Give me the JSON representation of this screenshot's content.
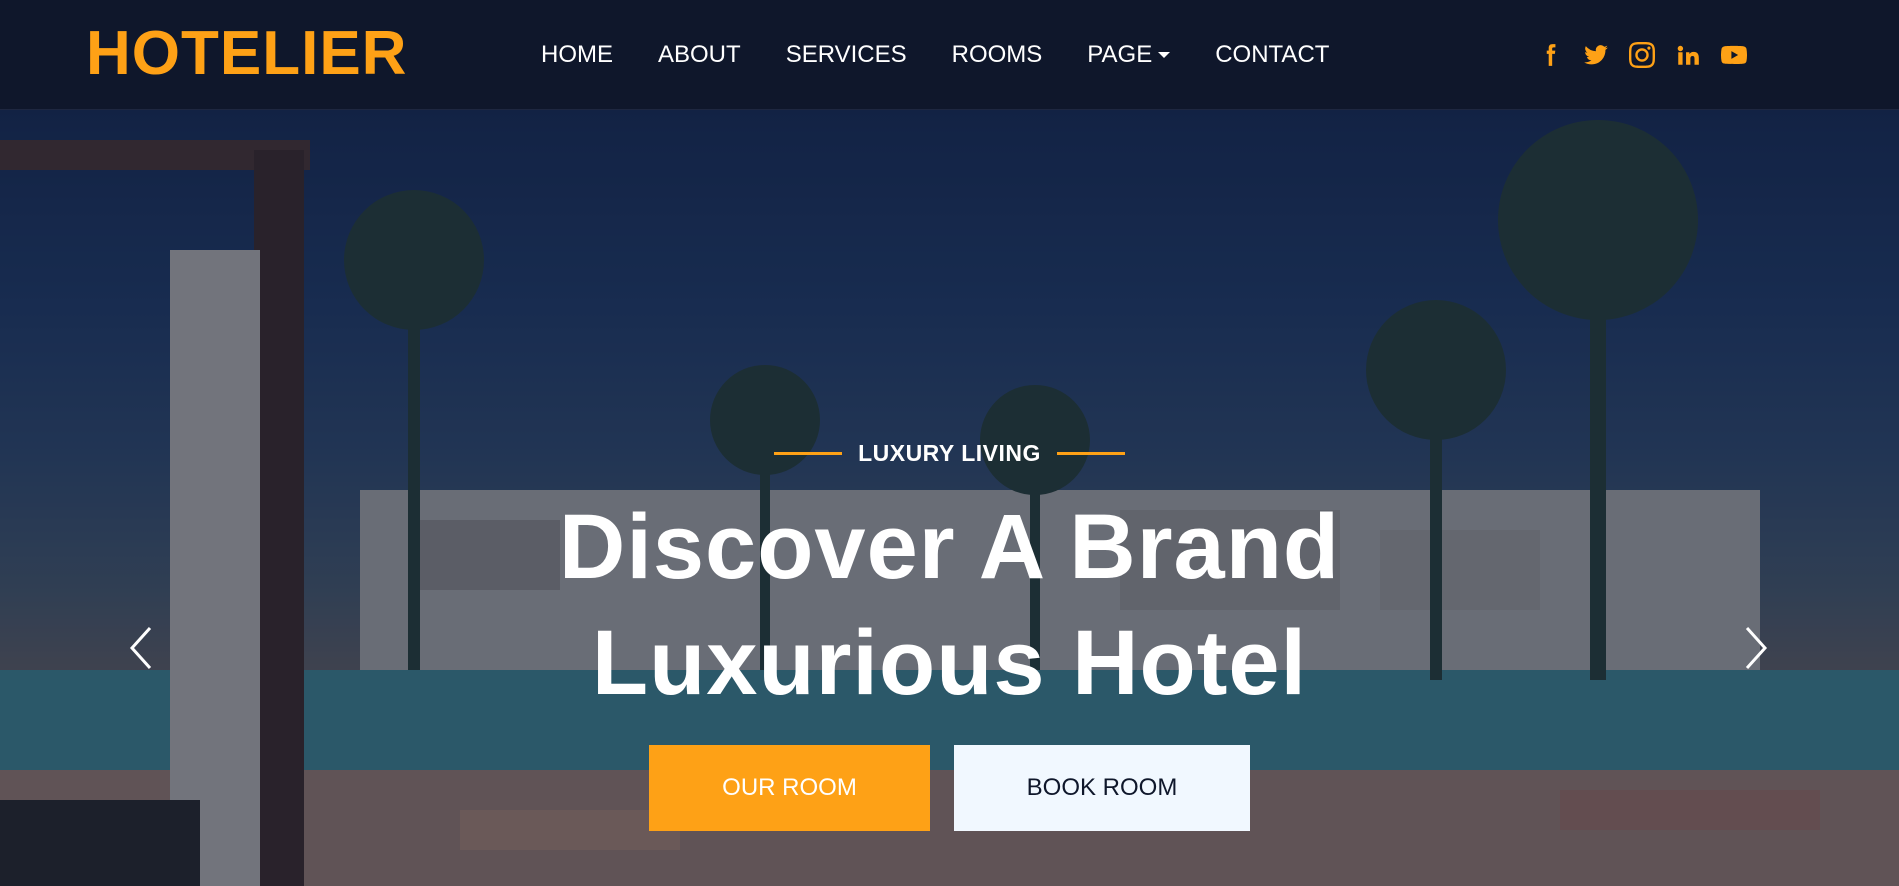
{
  "brand": {
    "name": "HOTELIER",
    "color": "#fea116"
  },
  "nav": {
    "items": [
      {
        "label": "HOME"
      },
      {
        "label": "ABOUT"
      },
      {
        "label": "SERVICES"
      },
      {
        "label": "ROOMS"
      },
      {
        "label": "PAGE",
        "dropdown": true
      },
      {
        "label": "CONTACT"
      }
    ]
  },
  "social": [
    {
      "icon": "facebook-icon"
    },
    {
      "icon": "twitter-icon"
    },
    {
      "icon": "instagram-icon"
    },
    {
      "icon": "linkedin-icon"
    },
    {
      "icon": "youtube-icon"
    }
  ],
  "hero": {
    "eyebrow": "LUXURY LIVING",
    "headline_line1": "Discover A Brand",
    "headline_line2": "Luxurious Hotel",
    "primary_button": "OUR ROOM",
    "secondary_button": "BOOK ROOM",
    "prev_icon": "chevron-left-icon",
    "next_icon": "chevron-right-icon"
  },
  "colors": {
    "accent": "#fea116",
    "dark": "#0f172b",
    "light": "#f1f8ff"
  }
}
